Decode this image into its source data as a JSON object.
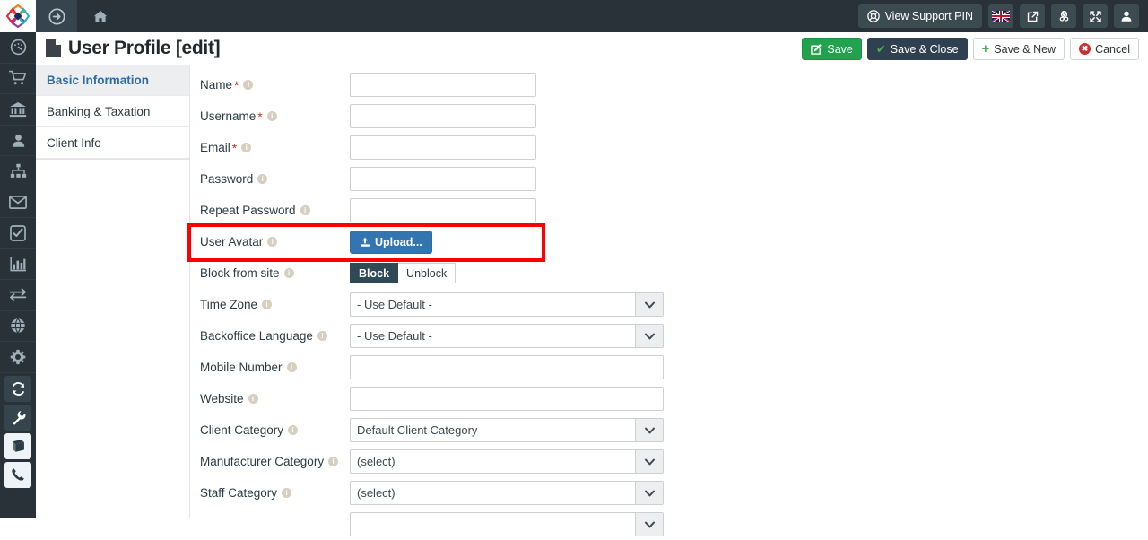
{
  "topbar": {
    "logo_icon": "diamond-logo-icon",
    "forward_icon": "arrow-circle-right-icon",
    "home_icon": "home-icon",
    "support_pin_label": "View Support PIN",
    "support_pin_icon": "lifebuoy-icon",
    "flag_icon": "uk-flag-icon",
    "external_link_icon": "external-link-icon",
    "joomla_icon": "joomla-icon",
    "expand_icon": "expand-arrows-icon",
    "user_icon": "user-icon",
    "bg_color": "#283238"
  },
  "rail": {
    "items": [
      {
        "icon": "dashboard-gauge-icon",
        "style": "plain"
      },
      {
        "icon": "shopping-cart-icon",
        "style": "plain"
      },
      {
        "icon": "bank-icon",
        "style": "plain"
      },
      {
        "icon": "user-icon",
        "style": "plain"
      },
      {
        "icon": "sitemap-icon",
        "style": "plain"
      },
      {
        "icon": "envelope-icon",
        "style": "plain"
      },
      {
        "icon": "check-square-icon",
        "style": "plain"
      },
      {
        "icon": "bar-chart-icon",
        "style": "plain"
      },
      {
        "icon": "exchange-arrows-icon",
        "style": "plain"
      },
      {
        "icon": "globe-icon",
        "style": "plain"
      },
      {
        "icon": "gear-icon",
        "style": "plain"
      },
      {
        "icon": "refresh-icon",
        "style": "boxed"
      },
      {
        "icon": "wrench-icon",
        "style": "boxed"
      },
      {
        "icon": "book-icon",
        "style": "light"
      },
      {
        "icon": "phone-icon",
        "style": "light"
      }
    ]
  },
  "header": {
    "title": "User Profile [edit]",
    "title_icon": "file-document-icon",
    "actions": {
      "save": "Save",
      "save_close": "Save & Close",
      "save_new": "Save & New",
      "cancel": "Cancel"
    },
    "save_color": "#23a24d",
    "save_close_color": "#2f4050"
  },
  "tabs": [
    {
      "label": "Basic Information",
      "active": true
    },
    {
      "label": "Banking & Taxation",
      "active": false
    },
    {
      "label": "Client Info",
      "active": false
    }
  ],
  "form": {
    "fields": [
      {
        "label": "Name",
        "required": true,
        "type": "text",
        "size": "short",
        "value": ""
      },
      {
        "label": "Username",
        "required": true,
        "type": "text",
        "size": "short",
        "value": ""
      },
      {
        "label": "Email",
        "required": true,
        "type": "text",
        "size": "short",
        "value": ""
      },
      {
        "label": "Password",
        "required": false,
        "type": "text",
        "size": "short",
        "value": ""
      },
      {
        "label": "Repeat Password",
        "required": false,
        "type": "text",
        "size": "short",
        "value": ""
      },
      {
        "label": "User Avatar",
        "required": false,
        "type": "upload",
        "upload_label": "Upload..."
      },
      {
        "label": "Block from site",
        "required": false,
        "type": "toggle",
        "on_label": "Block",
        "off_label": "Unblock",
        "selected": "Block"
      },
      {
        "label": "Time Zone",
        "required": false,
        "type": "select",
        "value": "- Use Default -"
      },
      {
        "label": "Backoffice Language",
        "required": false,
        "type": "select",
        "value": "- Use Default -"
      },
      {
        "label": "Mobile Number",
        "required": false,
        "type": "text",
        "size": "wide",
        "value": ""
      },
      {
        "label": "Website",
        "required": false,
        "type": "text",
        "size": "wide",
        "value": ""
      },
      {
        "label": "Client Category",
        "required": false,
        "type": "select",
        "value": "Default Client Category"
      },
      {
        "label": "Manufacturer Category",
        "required": false,
        "type": "select",
        "value": "(select)"
      },
      {
        "label": "Staff Category",
        "required": false,
        "type": "select",
        "value": "(select)"
      },
      {
        "label": "",
        "required": false,
        "type": "select",
        "value": ""
      }
    ]
  },
  "annotation": {
    "color": "#ff0000",
    "target": "user-avatar-upload-row"
  }
}
